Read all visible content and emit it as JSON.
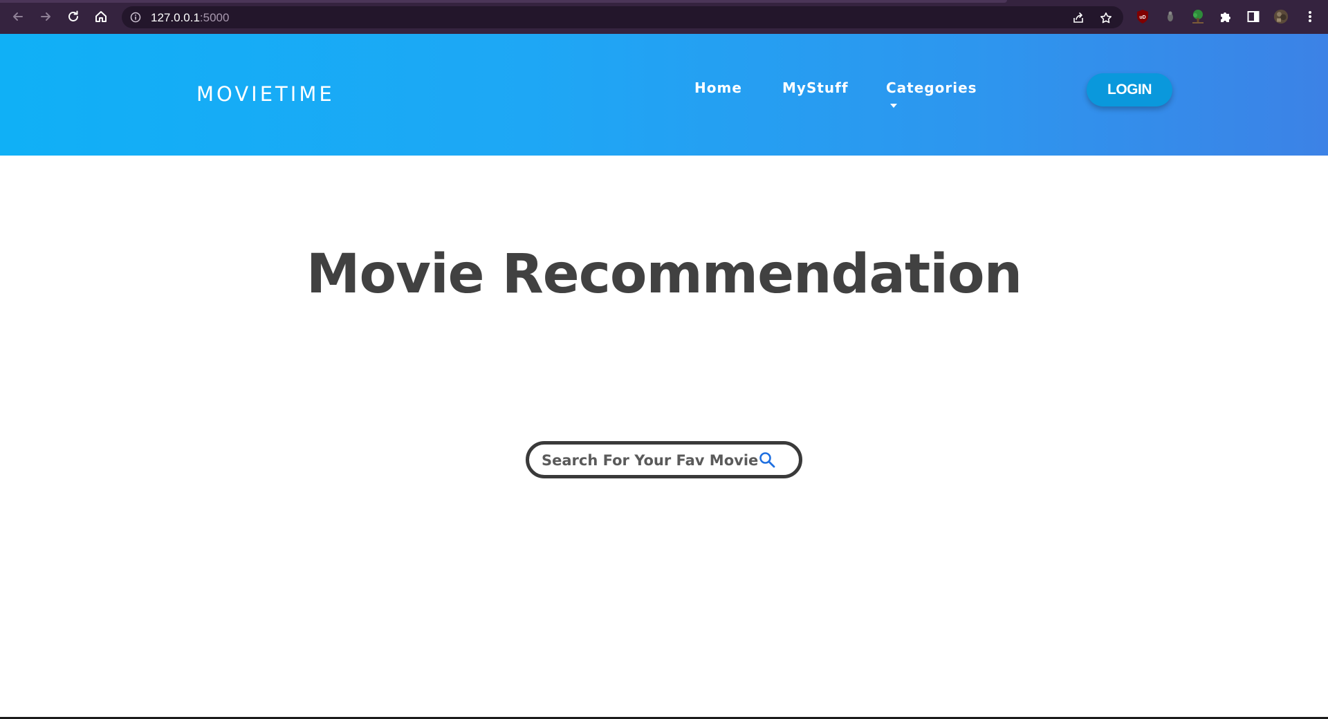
{
  "browser": {
    "url_host": "127.0.0.1",
    "url_port": ":5000",
    "icons": {
      "back": "arrow-left-icon",
      "forward": "arrow-right-icon",
      "reload": "reload-icon",
      "home": "home-icon",
      "info": "info-icon",
      "share": "share-icon",
      "bookmark": "star-icon",
      "extensions": "puzzle-icon",
      "side_panel": "side-panel-icon",
      "menu": "kebab-menu-icon"
    },
    "ublock_label": "uD",
    "colors": {
      "frame": "#35233f",
      "omnibox": "#23162b"
    }
  },
  "header": {
    "logo": "MOVIETIME",
    "nav": {
      "home": "Home",
      "mystuff": "MyStuff",
      "categories": "Categories"
    },
    "login_label": "LOGIN",
    "colors": {
      "gradient_start": "#10b0f6",
      "gradient_end": "#3c82e6",
      "login_bg": "#0a98dc"
    }
  },
  "main": {
    "title": "Movie Recommendation",
    "search": {
      "placeholder": "Search For Your Fav Movie",
      "icon": "search-icon",
      "icon_color": "#1e6fe0"
    }
  }
}
